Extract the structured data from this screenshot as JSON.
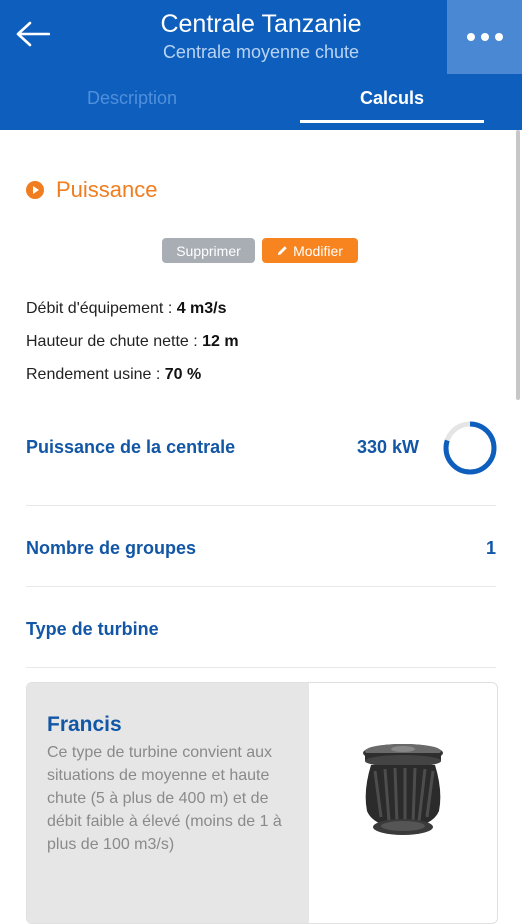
{
  "header": {
    "title": "Centrale Tanzanie",
    "subtitle": "Centrale moyenne chute",
    "back_icon": "arrow-left-icon",
    "more_icon": "more-horizontal-icon"
  },
  "tabs": [
    {
      "label": "Description",
      "active": false
    },
    {
      "label": "Calculs",
      "active": true
    }
  ],
  "section": {
    "title": "Puissance",
    "icon": "play-circle-icon"
  },
  "actions": {
    "delete_label": "Supprimer",
    "edit_label": "Modifier",
    "edit_icon": "pencil-icon"
  },
  "params": [
    {
      "label": "Débit d'équipement : ",
      "value": "4 m3/s"
    },
    {
      "label": "Hauteur de chute nette : ",
      "value": "12 m"
    },
    {
      "label": "Rendement usine : ",
      "value": "70 %"
    }
  ],
  "results": {
    "power_label": "Puissance de la centrale",
    "power_value": "330 kW",
    "power_gauge_fraction": 0.8,
    "groups_label": "Nombre de groupes",
    "groups_value": "1",
    "turbine_type_label": "Type de turbine"
  },
  "turbine_card": {
    "name": "Francis",
    "description": "Ce type de turbine convient aux situations de moyenne et haute chute (5 à plus de 400 m) et de débit faible à élevé (moins de 1 à plus de 100 m3/s)"
  },
  "colors": {
    "primary": "#0e5fbd",
    "accent": "#f07d1f",
    "label_blue": "#1256a6",
    "delete_gray": "#a8aeb4"
  }
}
